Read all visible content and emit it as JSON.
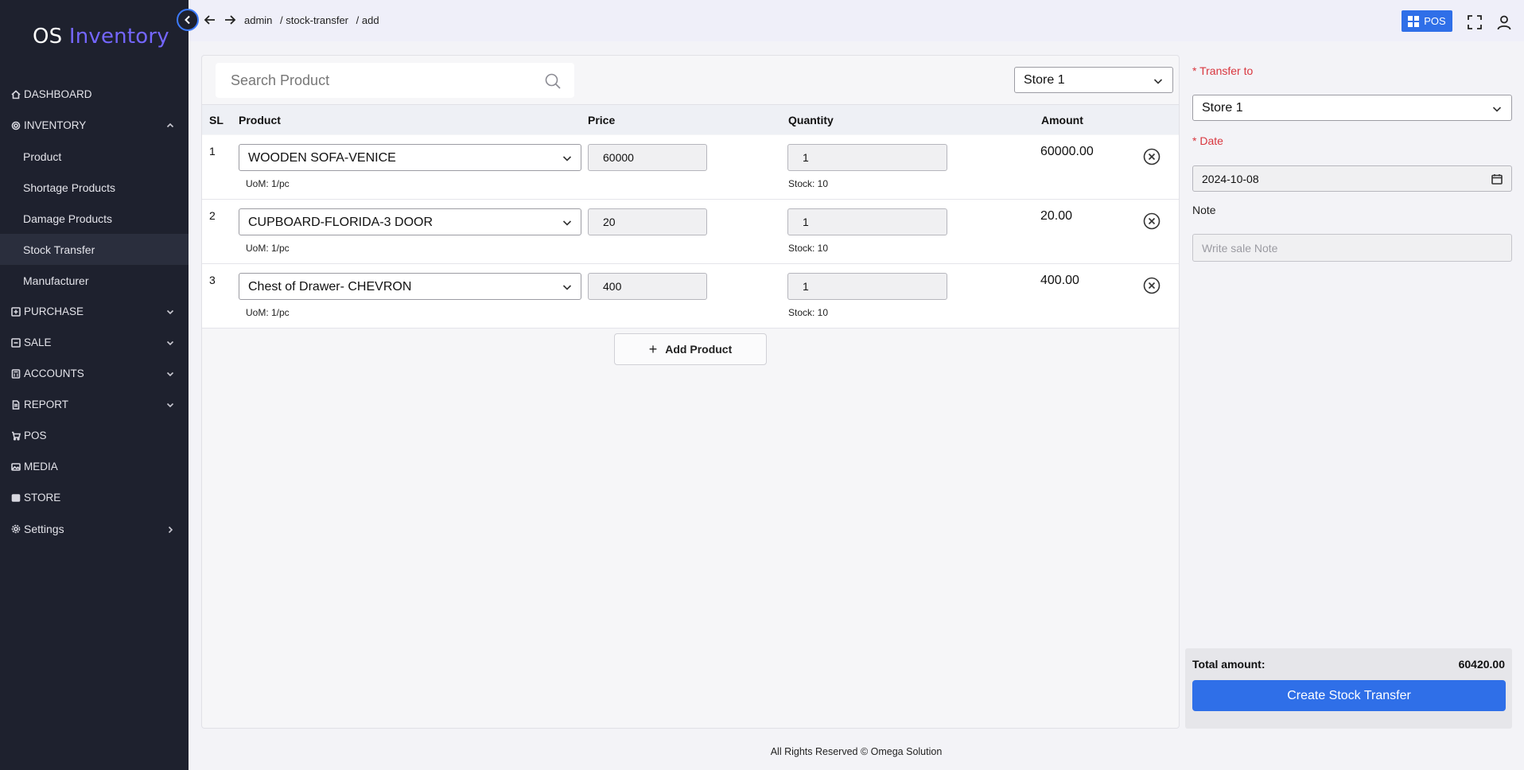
{
  "sidebar": {
    "logo_prefix": "OS",
    "logo_suffix": "Inventory",
    "items": [
      {
        "label": "DASHBOARD",
        "icon": "home-icon"
      },
      {
        "label": "INVENTORY",
        "icon": "gear-icon",
        "expanded": true
      },
      {
        "label": "Product"
      },
      {
        "label": "Shortage Products"
      },
      {
        "label": "Damage Products"
      },
      {
        "label": "Stock Transfer",
        "active": true
      },
      {
        "label": "Manufacturer"
      },
      {
        "label": "PURCHASE",
        "icon": "plus-square-icon"
      },
      {
        "label": "SALE",
        "icon": "minus-square-icon"
      },
      {
        "label": "ACCOUNTS",
        "icon": "calculator-icon"
      },
      {
        "label": "REPORT",
        "icon": "document-icon"
      },
      {
        "label": "POS",
        "icon": "cart-icon"
      },
      {
        "label": "MEDIA",
        "icon": "image-icon"
      },
      {
        "label": "STORE",
        "icon": "store-icon"
      },
      {
        "label": "Settings",
        "icon": "settings-icon"
      }
    ]
  },
  "topbar": {
    "breadcrumb": [
      "admin",
      "/ stock-transfer",
      "/ add"
    ],
    "pos_label": "POS"
  },
  "main": {
    "search_placeholder": "Search Product",
    "store_select": "Store 1",
    "columns": [
      "SL",
      "Product",
      "Price",
      "Quantity",
      "Amount"
    ],
    "rows": [
      {
        "sl": "1",
        "product": "WOODEN SOFA-VENICE",
        "uom": "UoM:  1/pc",
        "price": "60000",
        "qty": "1",
        "stock": "Stock:  10",
        "amount": "60000.00"
      },
      {
        "sl": "2",
        "product": "CUPBOARD-FLORIDA-3 DOOR",
        "uom": "UoM:  1/pc",
        "price": "20",
        "qty": "1",
        "stock": "Stock:  10",
        "amount": "20.00"
      },
      {
        "sl": "3",
        "product": "Chest of Drawer- CHEVRON",
        "uom": "UoM:  1/pc",
        "price": "400",
        "qty": "1",
        "stock": "Stock:  10",
        "amount": "400.00"
      }
    ],
    "add_product_label": "Add Product"
  },
  "right": {
    "transfer_to_label": "* Transfer to",
    "transfer_to_value": "Store 1",
    "date_label": "* Date",
    "date_value": "2024-10-08",
    "note_label": "Note",
    "note_placeholder": "Write sale Note",
    "total_label": "Total amount:",
    "total_value": "60420.00",
    "create_label": "Create Stock Transfer"
  },
  "footer": "All Rights Reserved © Omega Solution",
  "colors": {
    "sidebar_bg": "#1e212e",
    "accent": "#2f6fe8",
    "logo_accent": "#7466ff",
    "required": "#d9363e"
  }
}
